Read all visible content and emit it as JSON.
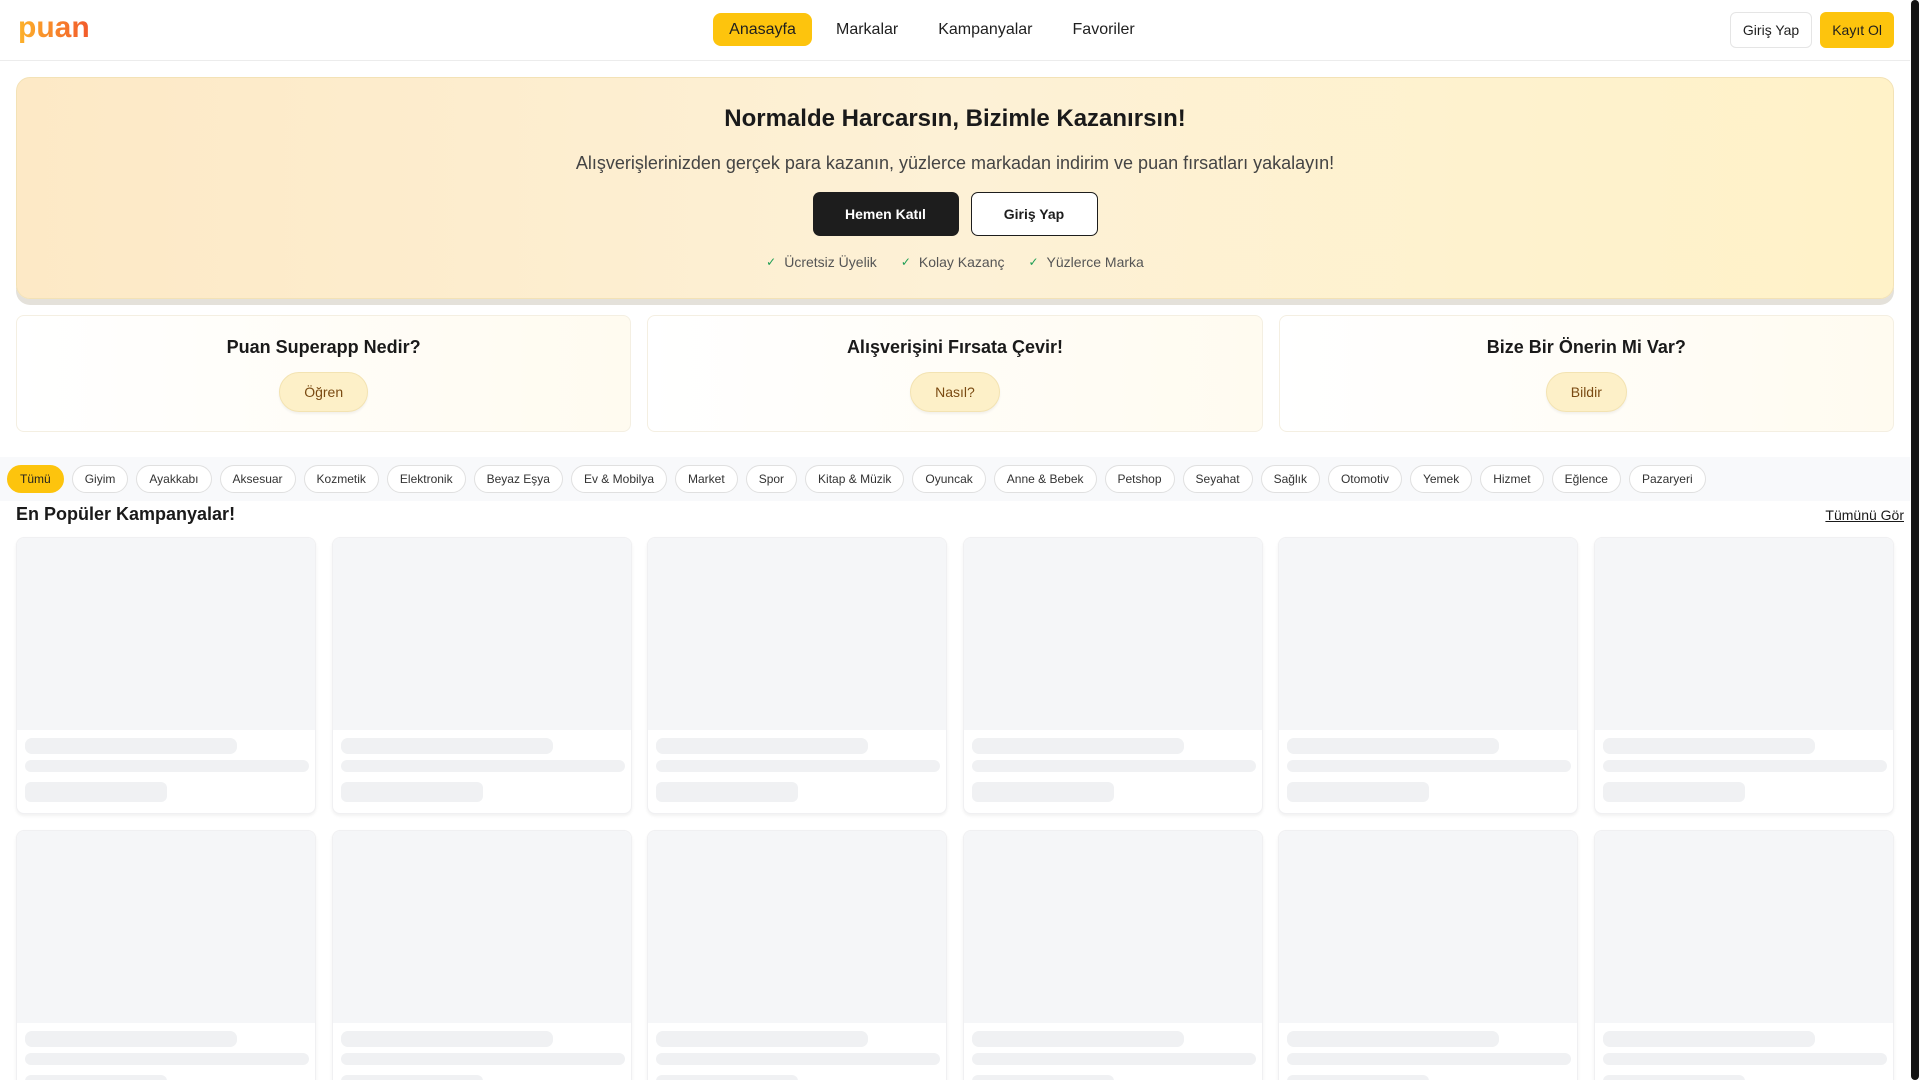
{
  "brand": {
    "logo_text": "puan",
    "accent": "#fdc40d"
  },
  "nav": {
    "items": [
      {
        "label": "Anasayfa",
        "active": true
      },
      {
        "label": "Markalar"
      },
      {
        "label": "Kampanyalar"
      },
      {
        "label": "Favoriler"
      }
    ]
  },
  "auth": {
    "login": "Giriş Yap",
    "register": "Kayıt Ol"
  },
  "hero": {
    "title": "Normalde Harcarsın, Bizimle Kazanırsın!",
    "subtitle": "Alışverişlerinizden gerçek para kazanın, yüzlerce markadan indirim ve puan fırsatları yakalayın!",
    "primary_cta": "Hemen Katıl",
    "secondary_cta": "Giriş Yap",
    "perks": [
      "Ücretsiz Üyelik",
      "Kolay Kazanç",
      "Yüzlerce Marka"
    ]
  },
  "info_cards": [
    {
      "title": "Puan Superapp Nedir?",
      "button": "Öğren"
    },
    {
      "title": "Alışverişini Fırsata Çevir!",
      "button": "Nasıl?"
    },
    {
      "title": "Bize Bir Önerin Mi Var?",
      "button": "Bildir"
    }
  ],
  "categories": [
    "Tümü",
    "Giyim",
    "Ayakkabı",
    "Aksesuar",
    "Kozmetik",
    "Elektronik",
    "Beyaz Eşya",
    "Ev & Mobilya",
    "Market",
    "Spor",
    "Kitap & Müzik",
    "Oyuncak",
    "Anne & Bebek",
    "Petshop",
    "Seyahat",
    "Sağlık",
    "Otomotiv",
    "Yemek",
    "Hizmet",
    "Eğlence",
    "Pazaryeri"
  ],
  "active_category": "Tümü",
  "popular": {
    "title": "En Popüler Kampanyalar!",
    "see_all": "Tümünü Gör",
    "loading_cards": 12
  }
}
